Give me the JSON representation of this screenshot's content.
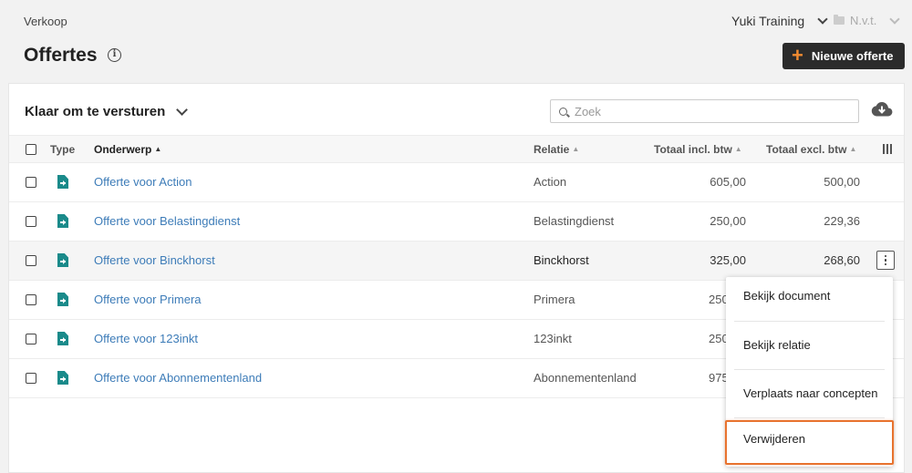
{
  "header": {
    "breadcrumb": "Verkoop",
    "organisation": "Yuki Training",
    "administration": "N.v.t."
  },
  "page": {
    "title": "Offertes",
    "new_button_label": "Nieuwe offerte"
  },
  "toolbar": {
    "list_filter": "Klaar om te versturen",
    "search_placeholder": "Zoek"
  },
  "table": {
    "columns": {
      "type": "Type",
      "subject": "Onderwerp",
      "relation": "Relatie",
      "total_incl": "Totaal incl. btw",
      "total_excl": "Totaal excl. btw"
    },
    "rows": [
      {
        "subject": "Offerte voor Action",
        "relation": "Action",
        "total_incl": "605,00",
        "total_excl": "500,00"
      },
      {
        "subject": "Offerte voor Belastingdienst",
        "relation": "Belastingdienst",
        "total_incl": "250,00",
        "total_excl": "229,36"
      },
      {
        "subject": "Offerte voor Binckhorst",
        "relation": "Binckhorst",
        "total_incl": "325,00",
        "total_excl": "268,60"
      },
      {
        "subject": "Offerte voor Primera",
        "relation": "Primera",
        "total_incl": "250",
        "total_excl": ""
      },
      {
        "subject": "Offerte voor 123inkt",
        "relation": "123inkt",
        "total_incl": "250",
        "total_excl": ""
      },
      {
        "subject": "Offerte voor Abonnementenland",
        "relation": "Abonnementenland",
        "total_incl": "975",
        "total_excl": ""
      }
    ]
  },
  "row_menu": {
    "items": [
      "Bekijk document",
      "Bekijk relatie",
      "Verplaats naar concepten",
      "Verwijderen"
    ]
  },
  "colors": {
    "accent": "#f28b30",
    "link": "#3d7cb8",
    "doc_icon": "#1a8a8a",
    "highlight_border": "#e8732f",
    "button_bg": "#2b2b2b"
  },
  "icons": [
    "chevron-down-icon",
    "folder-icon",
    "info-icon",
    "plus-icon",
    "search-icon",
    "cloud-download-icon",
    "sort-icon",
    "columns-icon",
    "document-icon",
    "more-vertical-icon"
  ]
}
